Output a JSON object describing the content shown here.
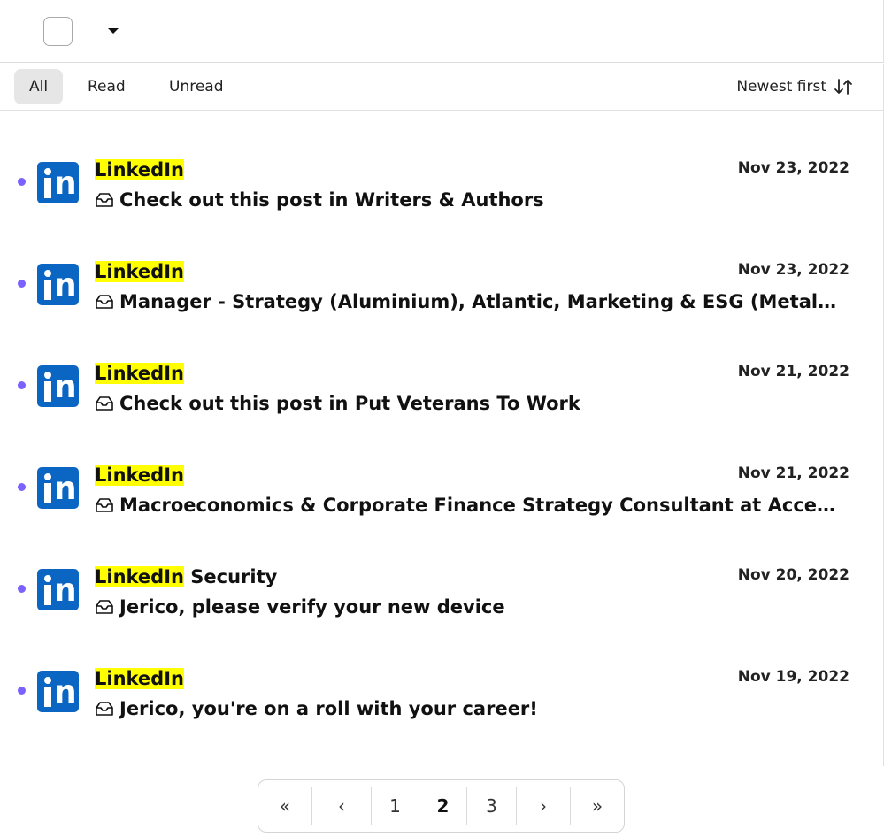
{
  "toolbar": {
    "select_all_checked": false
  },
  "filters": {
    "tabs": [
      {
        "label": "All",
        "active": true
      },
      {
        "label": "Read",
        "active": false
      },
      {
        "label": "Unread",
        "active": false
      }
    ],
    "sort_label": "Newest first"
  },
  "messages": [
    {
      "sender_highlight": "LinkedIn",
      "sender_rest": "",
      "subject": "Check out this post in Writers & Authors",
      "date": "Nov 23, 2022",
      "unread": true
    },
    {
      "sender_highlight": "LinkedIn",
      "sender_rest": "",
      "subject": "Manager - Strategy (Aluminium), Atlantic, Marketing & ESG (Metals and Mining)",
      "date": "Nov 23, 2022",
      "unread": true
    },
    {
      "sender_highlight": "LinkedIn",
      "sender_rest": "",
      "subject": "Check out this post in Put Veterans To Work",
      "date": "Nov 21, 2022",
      "unread": true
    },
    {
      "sender_highlight": "LinkedIn",
      "sender_rest": "",
      "subject": "Macroeconomics & Corporate Finance Strategy Consultant at Accenture",
      "date": "Nov 21, 2022",
      "unread": true
    },
    {
      "sender_highlight": "LinkedIn",
      "sender_rest": " Security",
      "subject": "Jerico, please verify your new device",
      "date": "Nov 20, 2022",
      "unread": true
    },
    {
      "sender_highlight": "LinkedIn",
      "sender_rest": "",
      "subject": "Jerico, you're on a roll with your career!",
      "date": "Nov 19, 2022",
      "unread": true
    }
  ],
  "pagination": {
    "first": "«",
    "prev": "‹",
    "pages": [
      "1",
      "2",
      "3"
    ],
    "current": "2",
    "next": "›",
    "last": "»"
  },
  "colors": {
    "unread_dot": "#7b61ff",
    "linkedin_blue": "#0a66c2",
    "highlight": "#ffff00"
  }
}
